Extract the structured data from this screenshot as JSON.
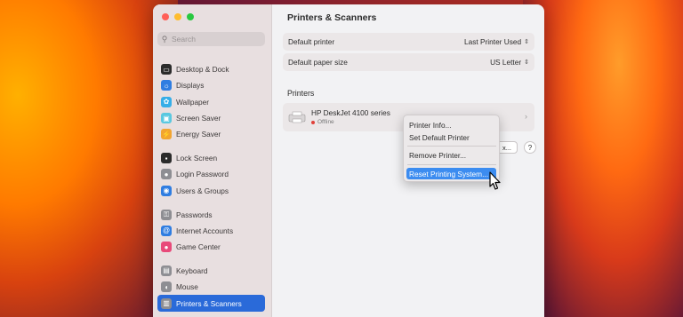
{
  "window": {
    "title": "Printers & Scanners"
  },
  "sidebar": {
    "search_placeholder": "Search",
    "items": [
      {
        "label": "Desktop & Dock",
        "icon": "desktop-dock-icon",
        "color": "#2b2b2b"
      },
      {
        "label": "Displays",
        "icon": "displays-icon",
        "color": "#2f7de1"
      },
      {
        "label": "Wallpaper",
        "icon": "wallpaper-icon",
        "color": "#35aee8"
      },
      {
        "label": "Screen Saver",
        "icon": "screen-saver-icon",
        "color": "#5ac8e0"
      },
      {
        "label": "Energy Saver",
        "icon": "energy-saver-icon",
        "color": "#f2a531"
      },
      {
        "label": "Lock Screen",
        "icon": "lock-screen-icon",
        "color": "#2b2b2b"
      },
      {
        "label": "Login Password",
        "icon": "login-password-icon",
        "color": "#8e8e93"
      },
      {
        "label": "Users & Groups",
        "icon": "users-groups-icon",
        "color": "#2f7de1"
      },
      {
        "label": "Passwords",
        "icon": "passwords-icon",
        "color": "#8e8e93"
      },
      {
        "label": "Internet Accounts",
        "icon": "internet-accounts-icon",
        "color": "#2f7de1"
      },
      {
        "label": "Game Center",
        "icon": "game-center-icon",
        "color": "#e84a7a"
      },
      {
        "label": "Keyboard",
        "icon": "keyboard-icon",
        "color": "#8e8e93"
      },
      {
        "label": "Mouse",
        "icon": "mouse-icon",
        "color": "#8e8e93"
      },
      {
        "label": "Printers & Scanners",
        "icon": "printers-scanners-icon",
        "color": "#8e8e93"
      }
    ],
    "active": "Printers & Scanners"
  },
  "settings": {
    "default_printer_label": "Default printer",
    "default_printer_value": "Last Printer Used",
    "default_paper_label": "Default paper size",
    "default_paper_value": "US Letter"
  },
  "printers": {
    "section_label": "Printers",
    "list": [
      {
        "name": "HP DeskJet 4100 series",
        "status": "Offline"
      }
    ],
    "button_partial": "x...",
    "help": "?"
  },
  "context_menu": {
    "items": [
      "Printer Info...",
      "Set Default Printer",
      "Remove Printer...",
      "Reset Printing System..."
    ],
    "highlighted": "Reset Printing System..."
  },
  "colors": {
    "accent": "#2a6ad9",
    "menu_highlight": "#3c8cf0",
    "offline_dot": "#e0413a"
  }
}
